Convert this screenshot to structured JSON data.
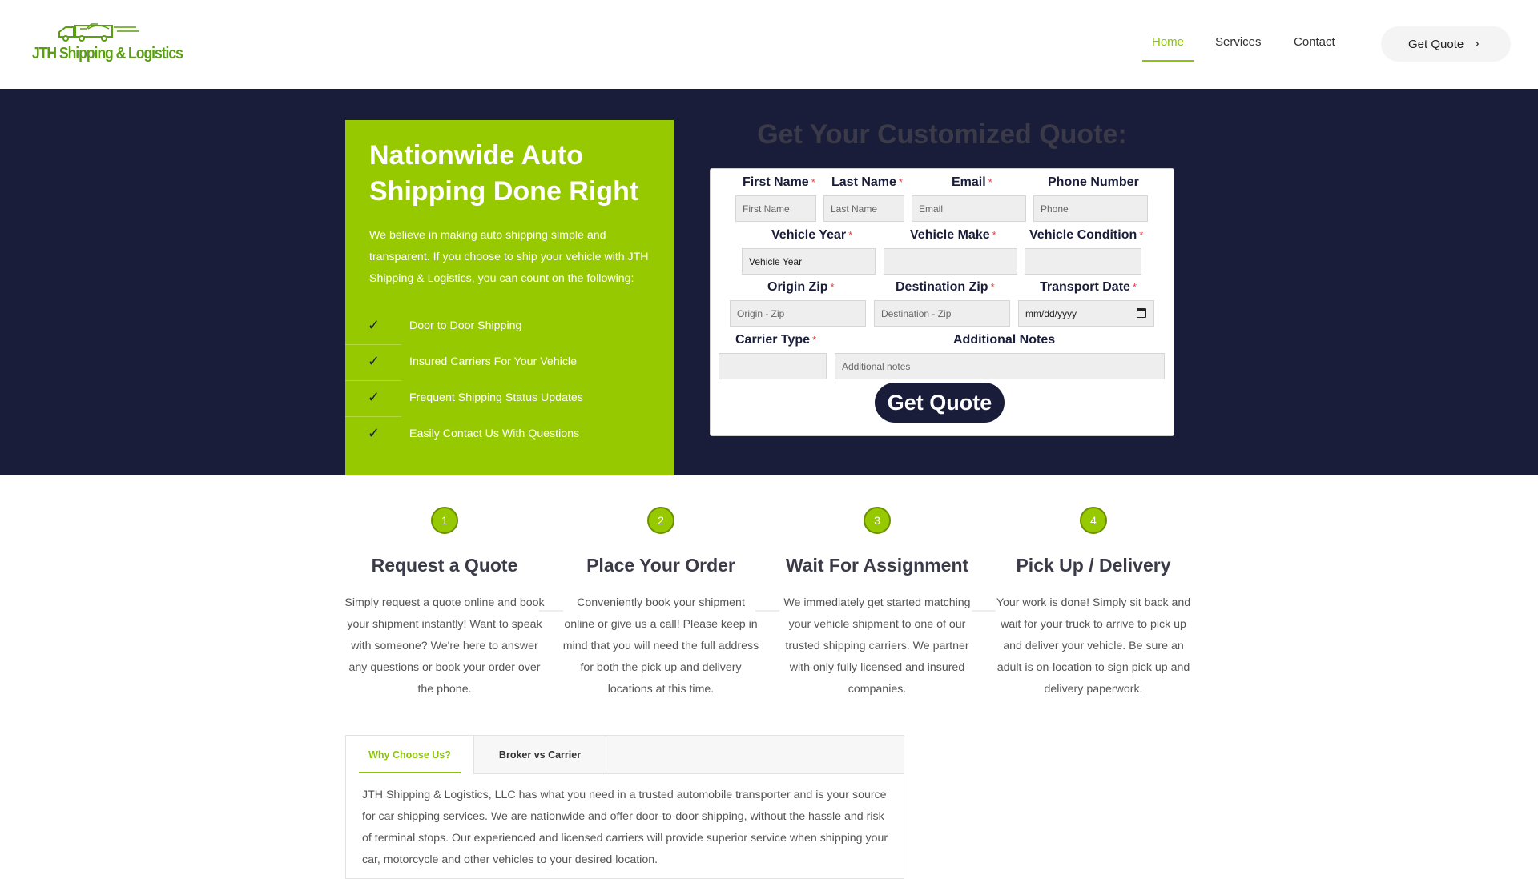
{
  "header": {
    "logo_text": "JTH Shipping & Logistics",
    "nav": [
      {
        "label": "Home",
        "active": true
      },
      {
        "label": "Services",
        "active": false
      },
      {
        "label": "Contact",
        "active": false
      }
    ],
    "cta_label": "Get Quote",
    "cta_icon": "chevron-right-icon",
    "accent_color": "#8cc40a"
  },
  "hero": {
    "background_color": "#1a1d3a",
    "panel_color": "#97c900",
    "title": "Nationwide Auto Shipping Done Right",
    "intro": "We believe in making auto shipping simple and transparent. If you choose to ship your vehicle with JTH Shipping & Logistics, you can count on the following:",
    "features": [
      "Door to Door Shipping",
      "Insured Carriers For Your Vehicle",
      "Frequent Shipping Status Updates",
      "Easily Contact Us With Questions"
    ],
    "feature_icon": "check-icon"
  },
  "quote_form": {
    "heading": "Get Your Customized Quote:",
    "required_mark": "*",
    "fields": {
      "first_name": {
        "label": "First Name",
        "placeholder": "First Name",
        "required": true
      },
      "last_name": {
        "label": "Last Name",
        "placeholder": "Last Name",
        "required": true
      },
      "email": {
        "label": "Email",
        "placeholder": "Email",
        "required": true
      },
      "phone": {
        "label": "Phone Number",
        "placeholder": "Phone",
        "required": false
      },
      "vehicle_year": {
        "label": "Vehicle Year",
        "value": "Vehicle Year",
        "required": true
      },
      "vehicle_make": {
        "label": "Vehicle Make",
        "value": "",
        "required": true
      },
      "vehicle_condition": {
        "label": "Vehicle Condition",
        "value": "",
        "required": true
      },
      "origin_zip": {
        "label": "Origin Zip",
        "placeholder": "Origin - Zip",
        "required": true
      },
      "destination_zip": {
        "label": "Destination Zip",
        "placeholder": "Destination - Zip",
        "required": true
      },
      "transport_date": {
        "label": "Transport Date",
        "placeholder": "mm/dd/yyyy",
        "required": true
      },
      "carrier_type": {
        "label": "Carrier Type",
        "value": "",
        "required": true
      },
      "additional_notes": {
        "label": "Additional Notes",
        "placeholder": "Additional notes",
        "required": false
      }
    },
    "submit_label": "Get Quote"
  },
  "steps": [
    {
      "number": "1",
      "title": "Request a Quote",
      "text": "Simply request a quote online and book your shipment instantly! Want to speak with someone? We're here to answer any questions or book your order over the phone."
    },
    {
      "number": "2",
      "title": "Place Your Order",
      "text": "Conveniently book your shipment online or give us a call! Please keep in mind that you will need the full address for both the pick up and delivery locations at this time."
    },
    {
      "number": "3",
      "title": "Wait For Assignment",
      "text": "We immediately get started matching your vehicle shipment to one of our trusted shipping carriers. We partner with only fully licensed and insured companies."
    },
    {
      "number": "4",
      "title": "Pick Up / Delivery",
      "text": "Your work is done! Simply sit back and wait for your truck to arrive to pick up and deliver your vehicle. Be sure an adult is on-location to sign pick up and delivery paperwork."
    }
  ],
  "tabs": {
    "items": [
      {
        "label": "Why Choose Us?",
        "active": true
      },
      {
        "label": "Broker vs Carrier",
        "active": false
      }
    ],
    "content": "JTH Shipping & Logistics, LLC has what you need in a trusted automobile transporter and is your source for car shipping services. We are nationwide and offer door-to-door shipping, without the hassle and risk of terminal stops. Our experienced and licensed carriers will provide superior service when shipping your car, motorcycle and other vehicles to your desired location."
  }
}
